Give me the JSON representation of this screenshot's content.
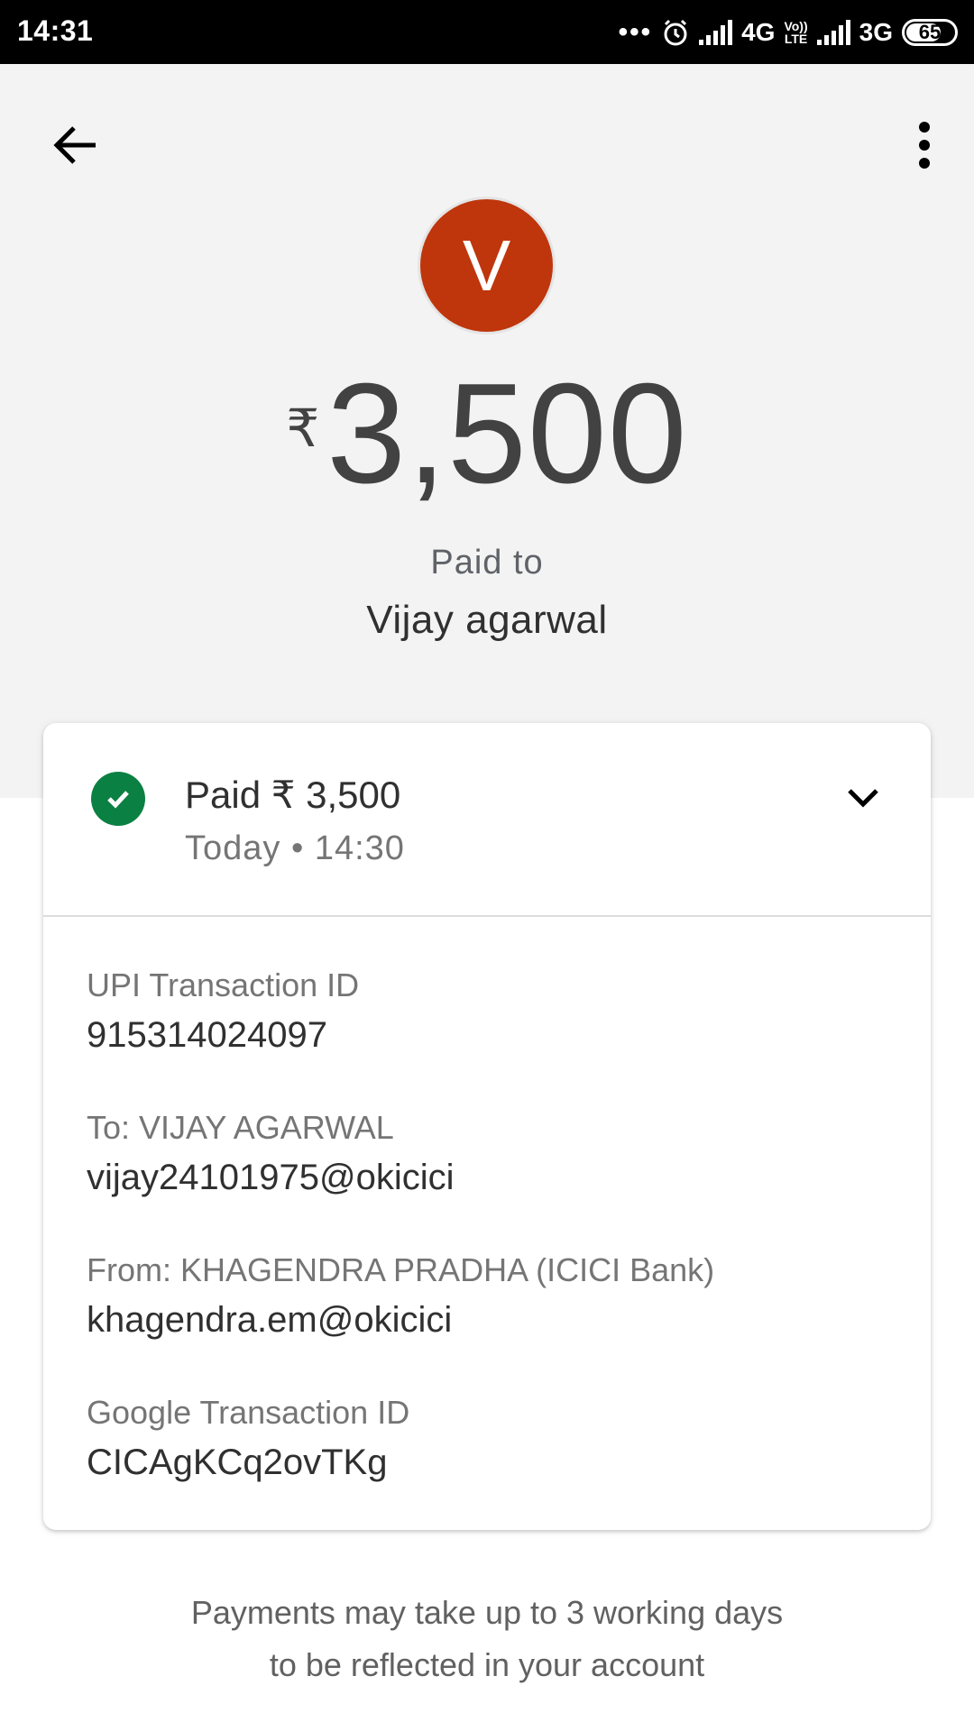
{
  "status_bar": {
    "time": "14:31",
    "network_1": "4G",
    "volte": [
      "Vo))",
      "LTE"
    ],
    "network_2": "3G",
    "battery": "65"
  },
  "header": {
    "avatar_letter": "V",
    "avatar_color": "#bf360c",
    "currency": "₹",
    "amount": "3,500",
    "paid_to_label": "Paid to",
    "payee_name": "Vijay agarwal"
  },
  "card": {
    "paid_summary": "Paid ₹ 3,500",
    "date_time": "Today • 14:30",
    "status_color": "#0b8043",
    "details": [
      {
        "label": "UPI Transaction ID",
        "value": "915314024097"
      },
      {
        "label": "To: VIJAY AGARWAL",
        "value": "vijay24101975@okicici"
      },
      {
        "label": "From: KHAGENDRA PRADHA (ICICI Bank)",
        "value": "khagendra.em@okicici"
      },
      {
        "label": "Google Transaction ID",
        "value": "CICAgKCq2ovTKg"
      }
    ]
  },
  "footer": {
    "line1": "Payments may take up to 3 working days",
    "line2": "to be reflected in your account"
  },
  "icons": [
    "back-arrow-icon",
    "more-vert-icon",
    "check-circle-icon",
    "chevron-down-icon",
    "alarm-icon",
    "signal-icon",
    "battery-icon"
  ]
}
